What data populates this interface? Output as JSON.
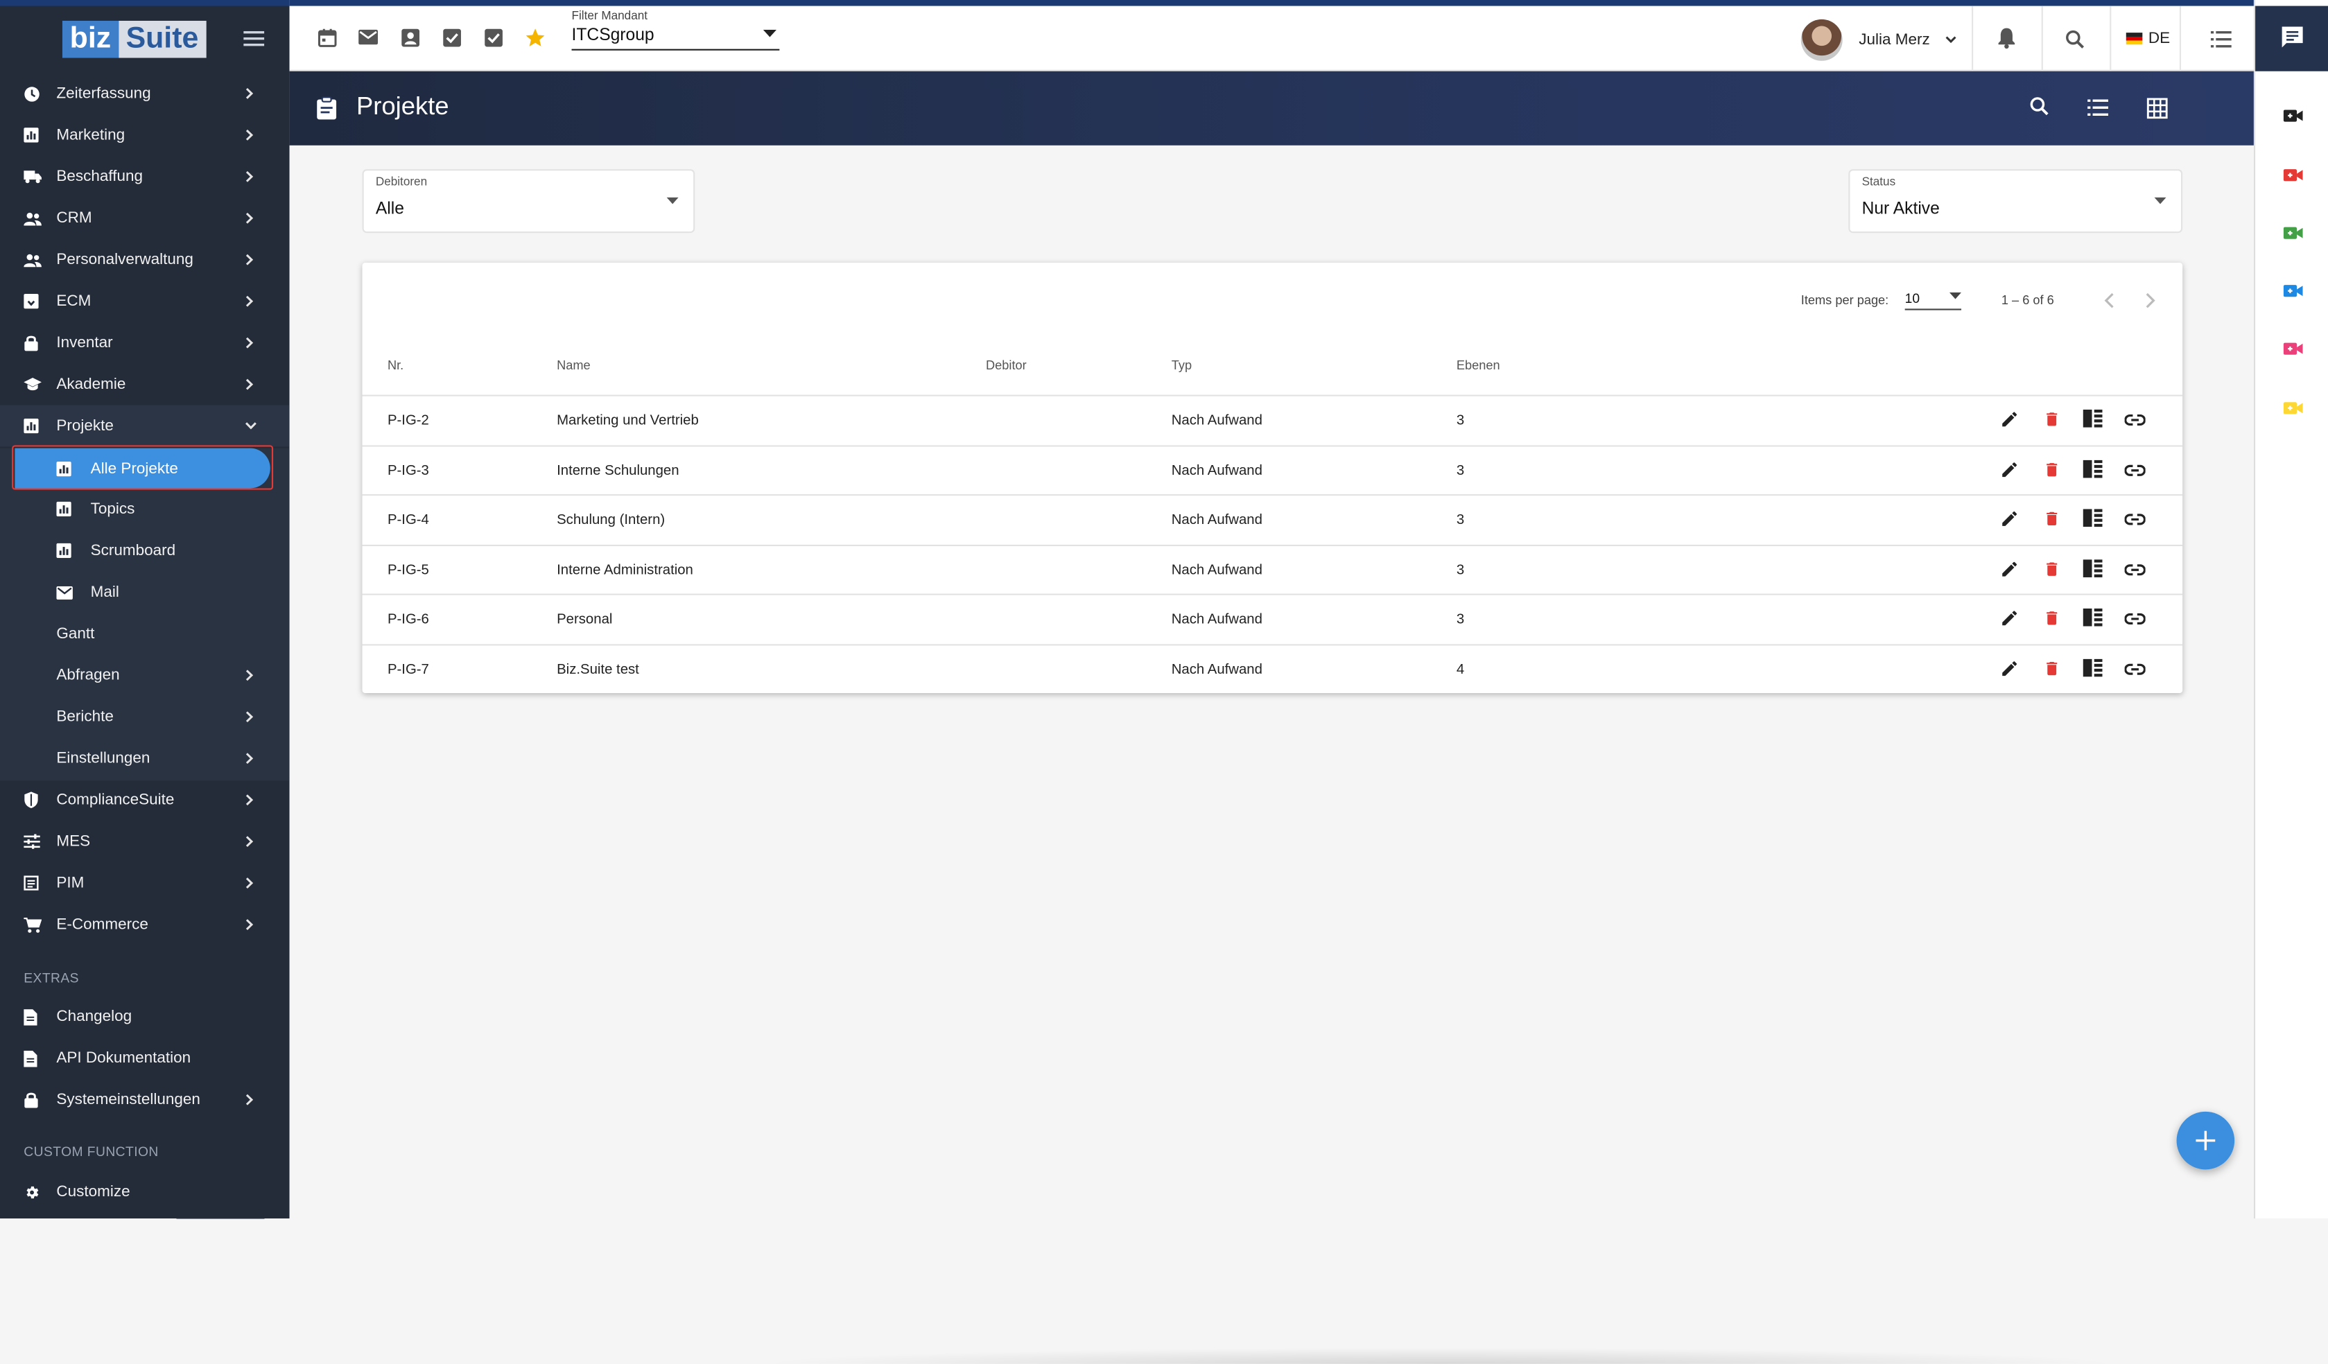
{
  "app": {
    "logo_biz": "biz",
    "logo_suite": "Suite"
  },
  "sidebar": {
    "items": [
      {
        "label": "Zeiterfassung",
        "icon": "clock-icon"
      },
      {
        "label": "Marketing",
        "icon": "chart-icon"
      },
      {
        "label": "Beschaffung",
        "icon": "truck-icon"
      },
      {
        "label": "CRM",
        "icon": "people-icon"
      },
      {
        "label": "Personalverwaltung",
        "icon": "people-icon"
      },
      {
        "label": "ECM",
        "icon": "archive-icon"
      },
      {
        "label": "Inventar",
        "icon": "lock-icon"
      },
      {
        "label": "Akademie",
        "icon": "school-icon"
      },
      {
        "label": "Projekte",
        "icon": "chart-icon"
      }
    ],
    "projekte_sub": [
      {
        "label": "Alle Projekte",
        "icon": "chart-icon"
      },
      {
        "label": "Topics",
        "icon": "chart-icon"
      },
      {
        "label": "Scrumboard",
        "icon": "chart-icon"
      },
      {
        "label": "Mail",
        "icon": "mail-icon"
      },
      {
        "label": "Gantt",
        "icon": ""
      },
      {
        "label": "Abfragen",
        "icon": ""
      },
      {
        "label": "Berichte",
        "icon": ""
      },
      {
        "label": "Einstellungen",
        "icon": ""
      }
    ],
    "items2": [
      {
        "label": "ComplianceSuite",
        "icon": "shield-icon"
      },
      {
        "label": "MES",
        "icon": "sliders-icon"
      },
      {
        "label": "PIM",
        "icon": "list-box-icon"
      },
      {
        "label": "E-Commerce",
        "icon": "cart-icon"
      }
    ],
    "extras_header": "EXTRAS",
    "extras": [
      {
        "label": "Changelog",
        "icon": "document-icon"
      },
      {
        "label": "API Dokumentation",
        "icon": "document-icon"
      },
      {
        "label": "Systemeinstellungen",
        "icon": "lock-icon"
      }
    ],
    "custom_header": "CUSTOM FUNCTION",
    "custom": [
      {
        "label": "Customize",
        "icon": "gear-icon"
      }
    ]
  },
  "topbar": {
    "filter_label": "Filter Mandant",
    "filter_value": "ITCSgroup",
    "user_name": "Julia Merz",
    "language": "DE"
  },
  "page": {
    "title": "Projekte"
  },
  "filters": {
    "debitoren_label": "Debitoren",
    "debitoren_value": "Alle",
    "status_label": "Status",
    "status_value": "Nur Aktive"
  },
  "pager": {
    "items_per_page_label": "Items per page:",
    "items_per_page": "10",
    "range": "1 – 6 of 6"
  },
  "table": {
    "columns": [
      "Nr.",
      "Name",
      "Debitor",
      "Typ",
      "Ebenen"
    ],
    "rows": [
      {
        "nr": "P-IG-2",
        "name": "Marketing und Vertrieb",
        "debitor": "",
        "typ": "Nach Aufwand",
        "ebenen": "3"
      },
      {
        "nr": "P-IG-3",
        "name": "Interne Schulungen",
        "debitor": "",
        "typ": "Nach Aufwand",
        "ebenen": "3"
      },
      {
        "nr": "P-IG-4",
        "name": "Schulung (Intern)",
        "debitor": "",
        "typ": "Nach Aufwand",
        "ebenen": "3"
      },
      {
        "nr": "P-IG-5",
        "name": "Interne Administration",
        "debitor": "",
        "typ": "Nach Aufwand",
        "ebenen": "3"
      },
      {
        "nr": "P-IG-6",
        "name": "Personal",
        "debitor": "",
        "typ": "Nach Aufwand",
        "ebenen": "3"
      },
      {
        "nr": "P-IG-7",
        "name": "Biz.Suite test",
        "debitor": "",
        "typ": "Nach Aufwand",
        "ebenen": "4"
      }
    ]
  },
  "colors": {
    "sidebar_bg": "#242c3a",
    "accent": "#3d8fe0",
    "delete": "#e53935",
    "star": "#f5b400",
    "rail_icons": [
      "#222222",
      "#e53935",
      "#43a047",
      "#1e88e5",
      "#ec407a",
      "#fdd835"
    ]
  }
}
